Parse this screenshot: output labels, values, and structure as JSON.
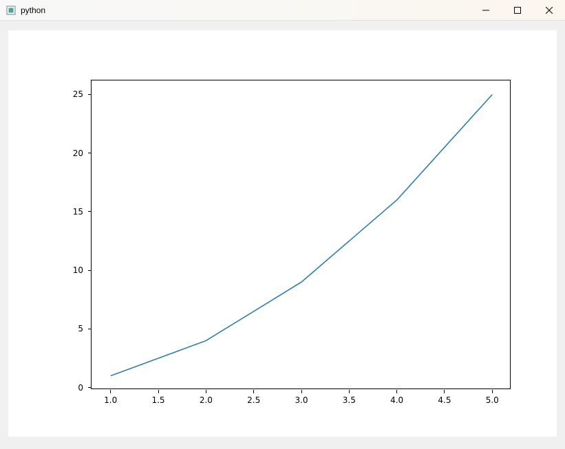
{
  "window": {
    "title": "python"
  },
  "chart_data": {
    "type": "line",
    "x": [
      1,
      2,
      3,
      4,
      5
    ],
    "y": [
      1,
      4,
      9,
      16,
      25
    ],
    "xticks": [
      1.0,
      1.5,
      2.0,
      2.5,
      3.0,
      3.5,
      4.0,
      4.5,
      5.0
    ],
    "xtick_labels": [
      "1.0",
      "1.5",
      "2.0",
      "2.5",
      "3.0",
      "3.5",
      "4.0",
      "4.5",
      "5.0"
    ],
    "yticks": [
      0,
      5,
      10,
      15,
      20,
      25
    ],
    "ytick_labels": [
      "0",
      "5",
      "10",
      "15",
      "20",
      "25"
    ],
    "xlim": [
      0.8,
      5.2
    ],
    "ylim": [
      -0.2,
      26.2
    ],
    "line_color": "#1f77b4",
    "title": "",
    "xlabel": "",
    "ylabel": ""
  }
}
